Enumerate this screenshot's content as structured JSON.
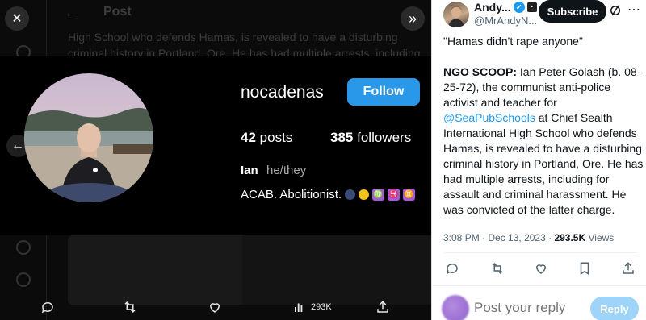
{
  "viewer": {
    "ghost": {
      "header": "Post",
      "text": "High School who defends Hamas, is revealed to have a disturbing criminal history in Portland, Ore. He has had multiple arrests, including"
    },
    "profile": {
      "username": "nocadenas",
      "follow_label": "Follow",
      "posts_count": "42",
      "posts_label": "posts",
      "followers_count": "385",
      "followers_label": "followers",
      "name": "Ian",
      "pronouns": "he/they",
      "bio": "ACAB. Abolitionist."
    },
    "actions": {
      "views": "293K"
    }
  },
  "tweet": {
    "author": {
      "name": "Andy...",
      "handle": "@MrAndyN..."
    },
    "subscribe_label": "Subscribe",
    "quote": "\"Hamas didn't rape anyone\"",
    "scoop_label": "NGO SCOOP:",
    "body_part1": " Ian Peter Golash (b. 08-25-72), the communist anti-police activist and teacher for ",
    "mention": "@SeaPubSchools",
    "body_part2": " at Chief Sealth International High School who defends Hamas, is revealed to have a disturbing criminal history in Portland, Ore. He has had multiple arrests, including for assault and criminal harassment. He was convicted of the latter charge.",
    "time": "3:08 PM",
    "date": "Dec 13, 2023",
    "views_count": "293.5K",
    "views_label": "Views",
    "reply_placeholder": "Post your reply",
    "reply_button": "Reply"
  },
  "colors": {
    "follow_blue": "#2a98e8",
    "x_blue": "#1d9bf0",
    "reply_disabled": "#8ecdf8"
  }
}
